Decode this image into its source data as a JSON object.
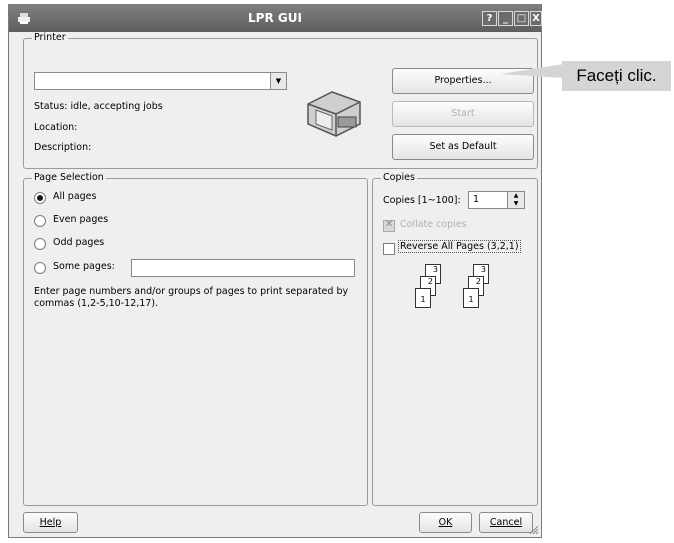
{
  "window": {
    "title": "LPR GUI",
    "titlebar_buttons": [
      "?",
      "_",
      "□",
      "X"
    ]
  },
  "printer": {
    "legend": "Printer",
    "selected_printer": "",
    "status": "Status: idle, accepting jobs",
    "location": "Location:",
    "description": "Description:",
    "properties_label": "Properties...",
    "start_label": "Start",
    "set_default_label": "Set as Default"
  },
  "page_selection": {
    "legend": "Page Selection",
    "all_pages": "All pages",
    "even_pages": "Even pages",
    "odd_pages": "Odd pages",
    "some_pages": "Some pages:",
    "some_pages_value": "",
    "help_text": "Enter page numbers and/or groups of pages to print separated by commas (1,2-5,10-12,17).",
    "selected": "All pages"
  },
  "copies": {
    "legend": "Copies",
    "copies_label": "Copies [1~100]:",
    "copies_value": "1",
    "collate_label": "Collate copies",
    "reverse_label": "Reverse All Pages (3,2,1)",
    "page_numbers": [
      "3",
      "2",
      "1"
    ]
  },
  "footer": {
    "help_label": "Help",
    "ok_label": "OK",
    "cancel_label": "Cancel"
  },
  "callout": {
    "text": "Faceți clic."
  }
}
